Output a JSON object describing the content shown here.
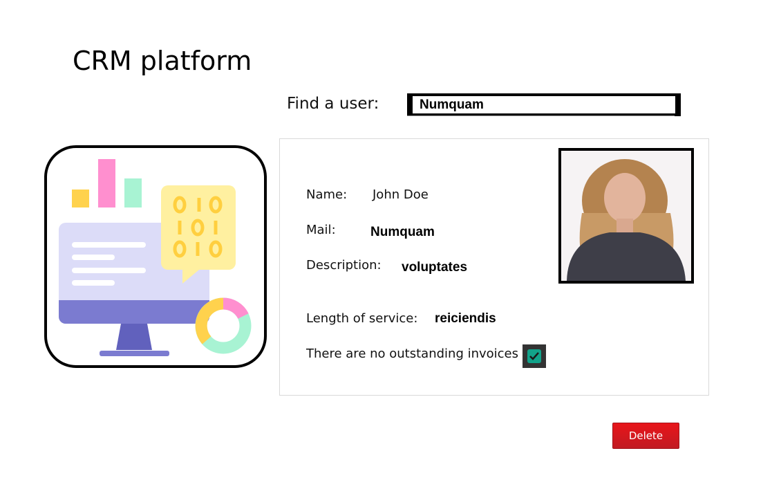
{
  "app": {
    "title": "CRM platform"
  },
  "search": {
    "label": "Find a user:",
    "value": "Numquam"
  },
  "user": {
    "name_label": "Name:",
    "name": "John Doe",
    "mail_label": "Mail:",
    "mail": "Numquam",
    "description_label": "Description:",
    "description": "voluptates",
    "service_label": "Length of service:",
    "service": "reiciendis",
    "invoices_label": "There are no outstanding invoices",
    "invoices_checked": true
  },
  "actions": {
    "delete_label": "Delete"
  },
  "colors": {
    "delete": "#e8151a",
    "checkbox": "#12a38a",
    "monitor": "#7b7bd0"
  },
  "icons": [
    "crm-illustration-icon",
    "check-icon"
  ]
}
